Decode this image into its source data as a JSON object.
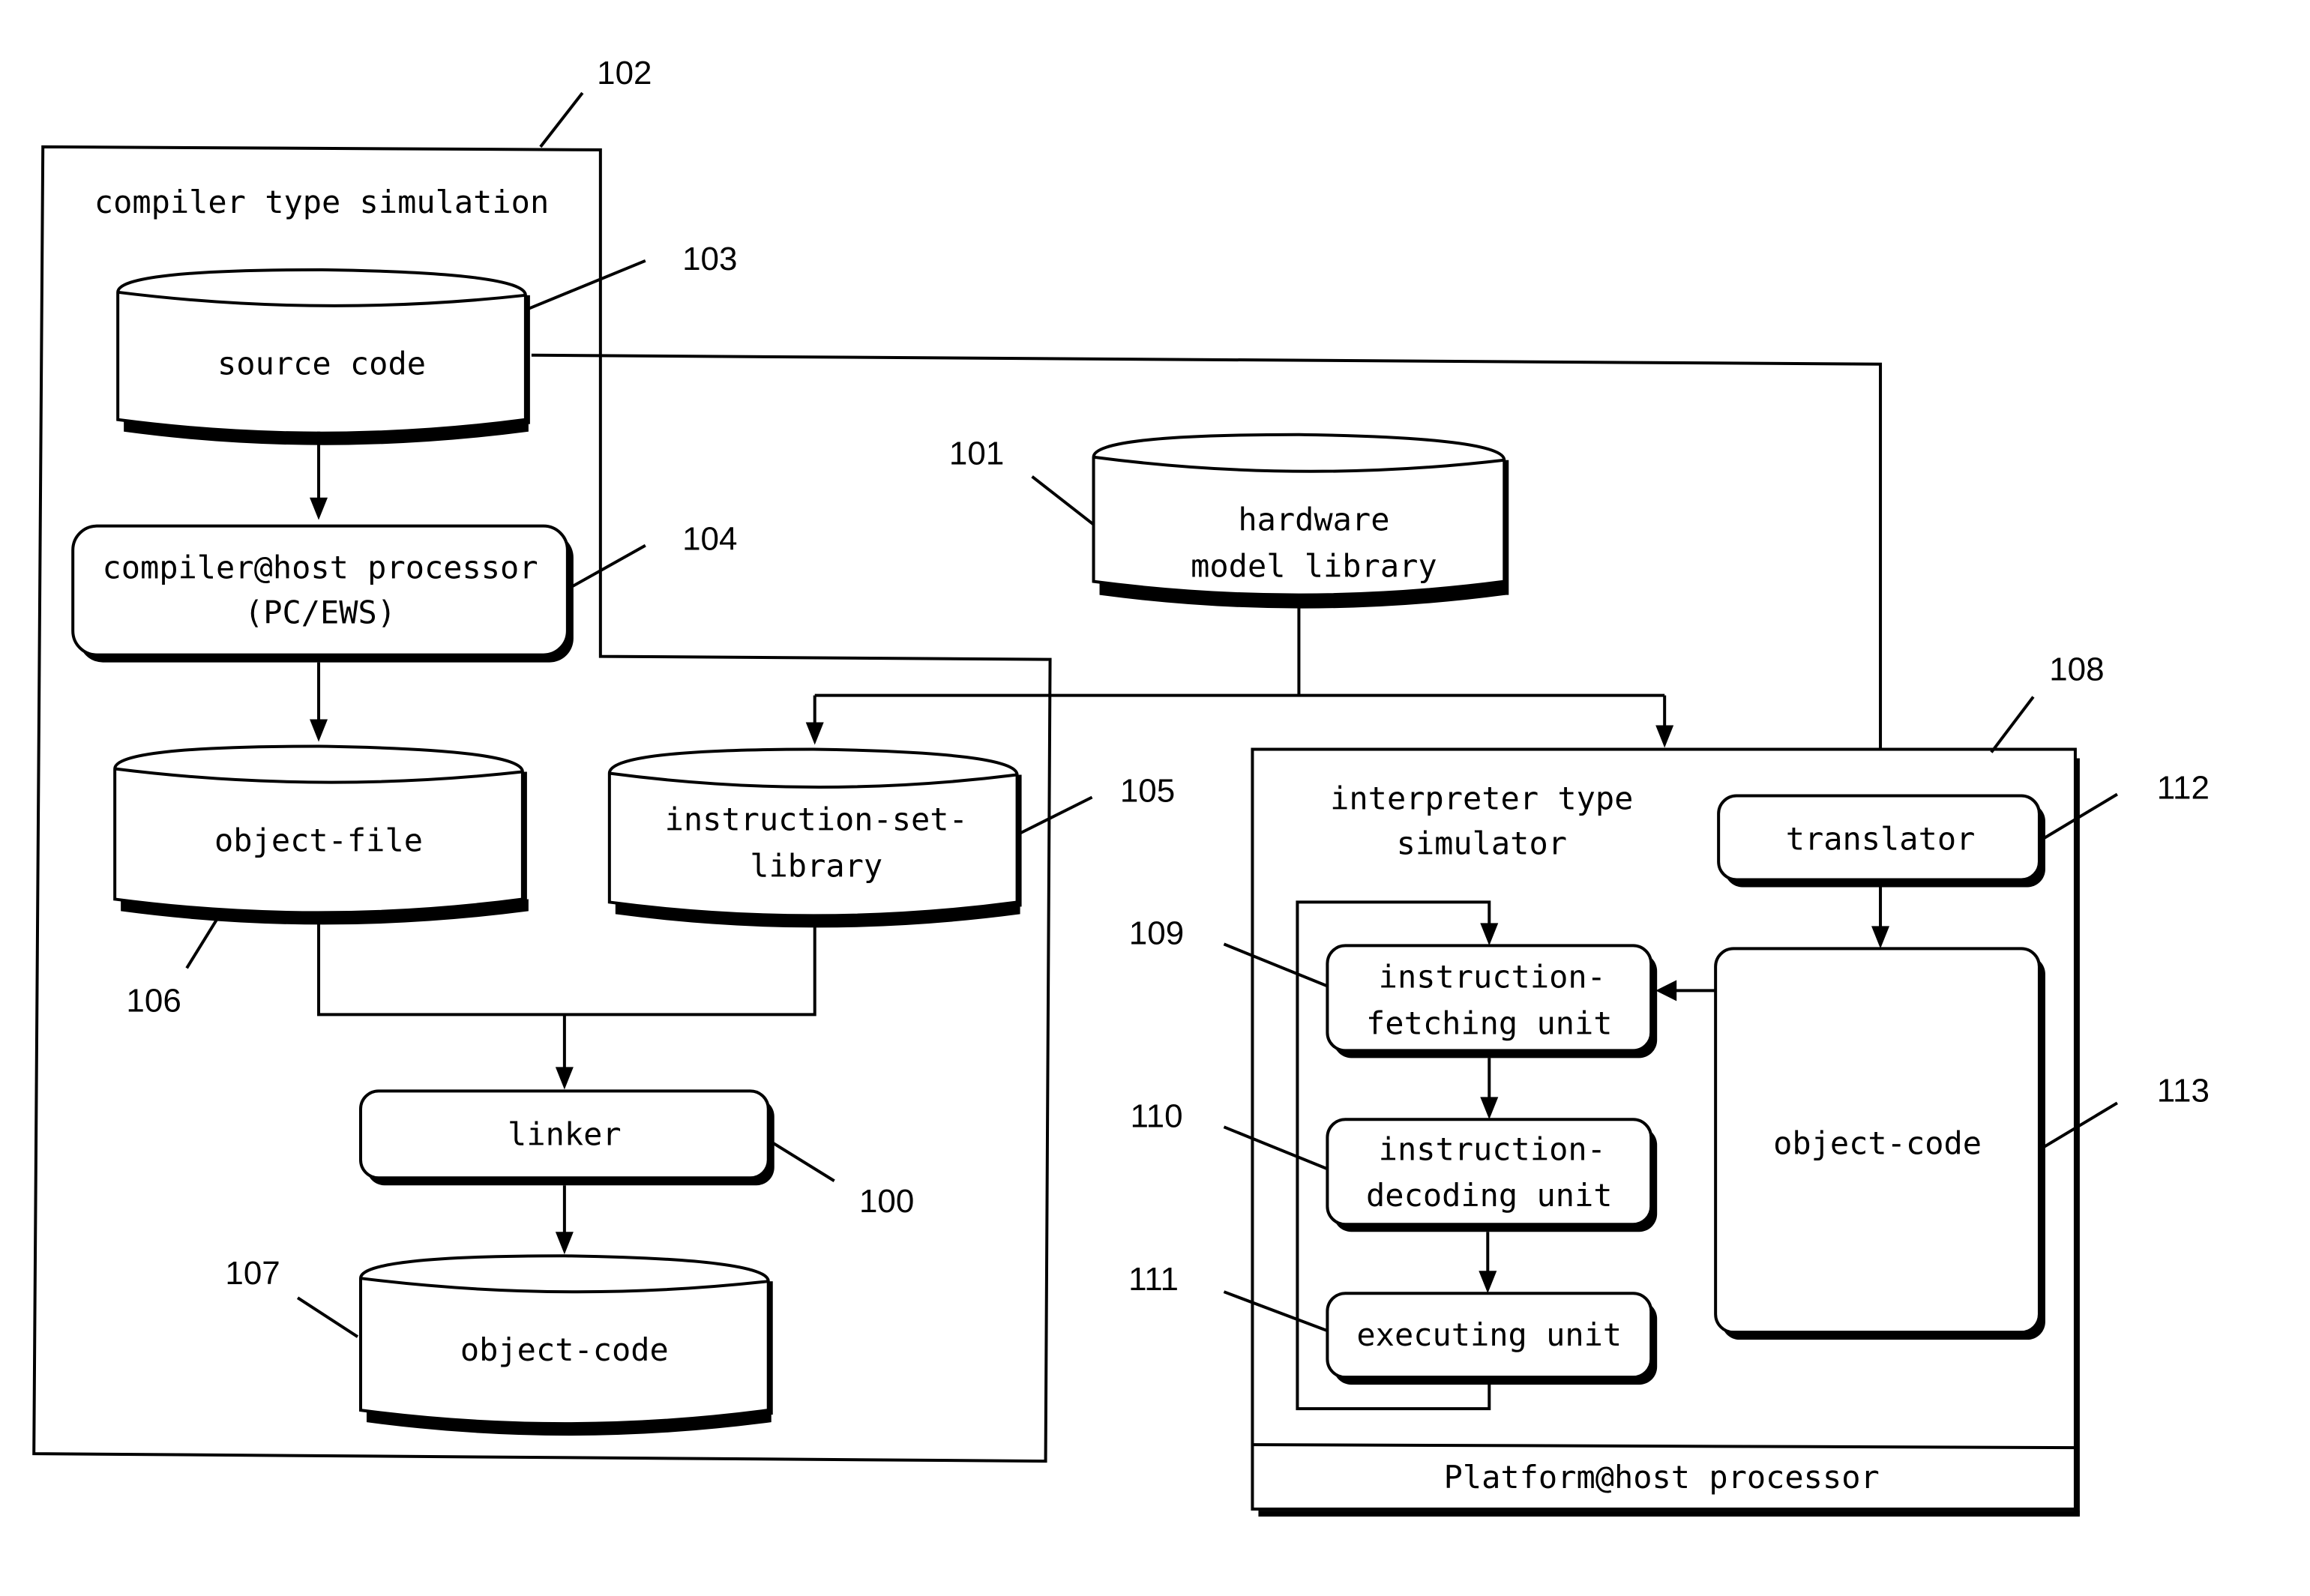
{
  "diagram": {
    "compiler_region": {
      "ref": "102",
      "title": "compiler type simulation"
    },
    "source_code": {
      "ref": "103",
      "label": "source code"
    },
    "compiler": {
      "ref": "104",
      "line1": "compiler@host processor",
      "line2": "(PC/EWS)"
    },
    "hardware_library": {
      "ref": "101",
      "line1": "hardware",
      "line2": "model library"
    },
    "object_file": {
      "ref": "106",
      "label": "object-file"
    },
    "instruction_set_library": {
      "ref": "105",
      "line1": "instruction-set-",
      "line2": "library"
    },
    "linker": {
      "ref": "100",
      "label": "linker"
    },
    "object_code_compiled": {
      "ref": "107",
      "label": "object-code"
    },
    "interpreter": {
      "ref": "108",
      "title_line1": "interpreter type",
      "title_line2": "simulator",
      "platform_label": "Platform@host processor"
    },
    "translator": {
      "ref": "112",
      "label": "translator"
    },
    "object_code_interp": {
      "ref": "113",
      "label": "object-code"
    },
    "fetch_unit": {
      "ref": "109",
      "line1": "instruction-",
      "line2": "fetching unit"
    },
    "decode_unit": {
      "ref": "110",
      "line1": "instruction-",
      "line2": "decoding unit"
    },
    "exec_unit": {
      "ref": "111",
      "label": "executing unit"
    }
  }
}
